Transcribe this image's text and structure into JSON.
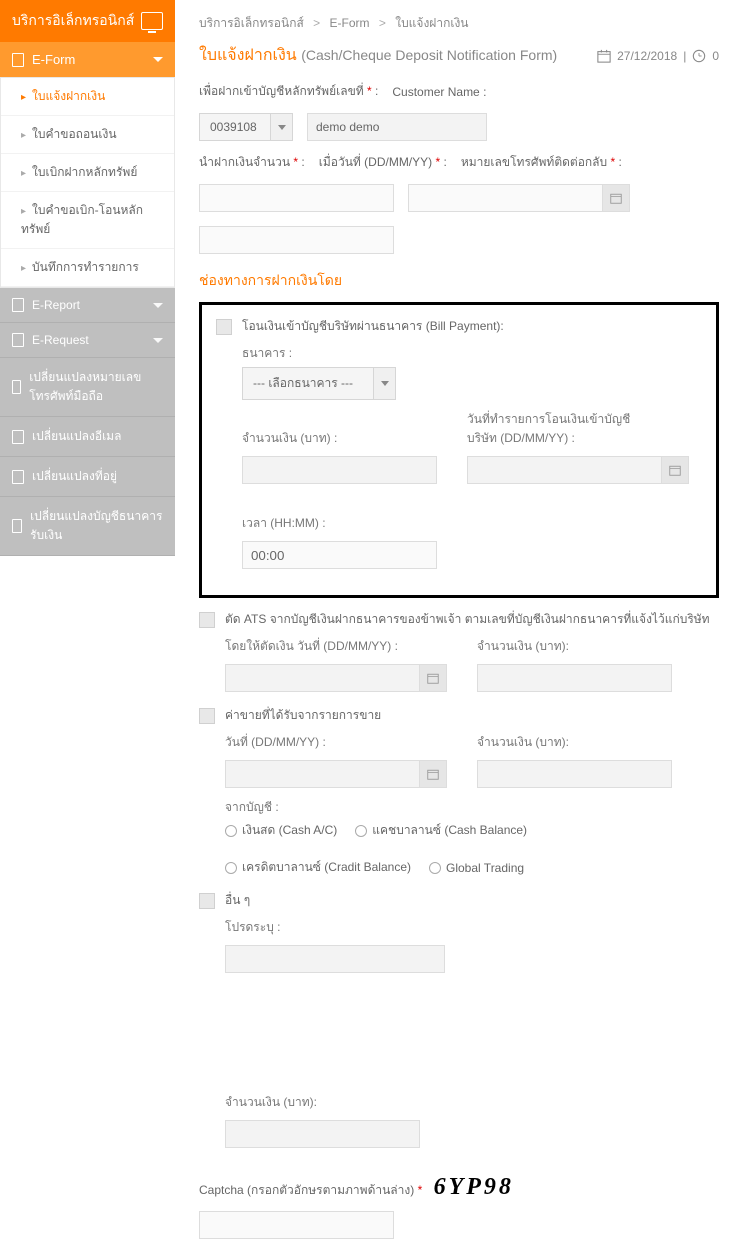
{
  "sidebar": {
    "header": "บริการอิเล็กทรอนิกส์",
    "eform": "E-Form",
    "submenu": [
      "ใบแจ้งฝากเงิน",
      "ใบคำขอถอนเงิน",
      "ใบเบิกฝากหลักทรัพย์",
      "ใบคำขอเบิก-โอนหลักทรัพย์",
      "บันทึกการทำรายการ"
    ],
    "ereport": "E-Report",
    "erequest": "E-Request",
    "items": [
      "เปลี่ยนแปลงหมายเลขโทรศัพท์มือถือ",
      "เปลี่ยนแปลงอีเมล",
      "เปลี่ยนแปลงที่อยู่",
      "เปลี่ยนแปลงบัญชีธนาคารรับเงิน"
    ]
  },
  "breadcrumb": {
    "a": "บริการอิเล็กทรอนิกส์",
    "b": "E-Form",
    "c": "ใบแจ้งฝากเงิน"
  },
  "title": {
    "main": "ใบแจ้งฝากเงิน",
    "sub": "(Cash/Cheque Deposit Notification Form)"
  },
  "meta": {
    "date": "27/12/2018",
    "time": "0"
  },
  "form": {
    "acct_label": "เพื่อฝากเข้าบัญชีหลักทรัพย์เลขที่",
    "acct_value": "0039108",
    "cust_label": "Customer Name :",
    "cust_value": "demo demo",
    "amount_label": "นำฝากเงินจำนวน",
    "date_label": "เมื่อวันที่ (DD/MM/YY)",
    "phone_label": "หมายเลขโทรศัพท์ติดต่อกลับ",
    "section": "ช่องทางการฝากเงินโดย",
    "opt1": {
      "title": "โอนเงินเข้าบัญชีบริษัทผ่านธนาคาร (Bill Payment):",
      "bank_label": "ธนาคาร :",
      "bank_placeholder": "--- เลือกธนาคาร ---",
      "amt_label": "จำนวนเงิน (บาท) :",
      "txndate_label": "วันที่ทำรายการโอนเงินเข้าบัญชีบริษัท (DD/MM/YY) :",
      "time_label": "เวลา (HH:MM) :",
      "time_value": "00:00"
    },
    "opt2": {
      "title": "ตัด ATS จากบัญชีเงินฝากธนาคารของข้าพเจ้า ตามเลขที่บัญชีเงินฝากธนาคารที่แจ้งไว้แก่บริษัท",
      "date_label": "โดยให้ตัดเงิน วันที่ (DD/MM/YY) :",
      "amt_label": "จำนวนเงิน (บาท):"
    },
    "opt3": {
      "title": "ค่าขายที่ได้รับจากรายการขาย",
      "date_label": "วันที่ (DD/MM/YY) :",
      "amt_label": "จำนวนเงิน (บาท):",
      "from_label": "จากบัญชี :",
      "r1": "เงินสด (Cash A/C)",
      "r2": "แคชบาลานซ์ (Cash Balance)",
      "r3": "เครดิตบาลานซ์ (Cradit Balance)",
      "r4": "Global Trading"
    },
    "opt4": {
      "title": "อื่น ๆ",
      "specify": "โปรดระบุ :",
      "amt_label": "จำนวนเงิน (บาท):"
    },
    "captcha_label": "Captcha (กรอกตัวอักษรตามภาพด้านล่าง)",
    "captcha_value": "6YP98"
  }
}
